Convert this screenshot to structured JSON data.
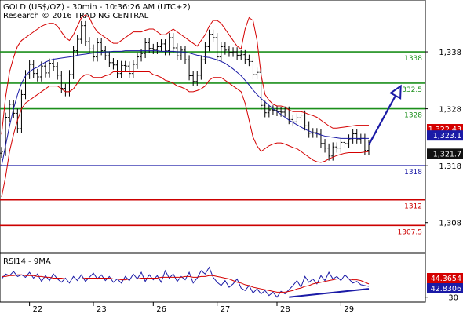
{
  "header": {
    "line1": "GOLD (US$/OZ) - 30min - 10:36:26 AM (UTC+2)",
    "line2": "Research © 2016 TRADING CENTRAL"
  },
  "chart_data": [
    {
      "type": "line",
      "title": "GOLD (US$/OZ) - 30min - 10:36:26 AM (UTC+2)",
      "subtitle": "Research © 2016 TRADING CENTRAL",
      "x_axis": {
        "tick_labels": [
          "22",
          "23",
          "26",
          "27",
          "28",
          "29"
        ]
      },
      "y_axis": {
        "range": [
          1303,
          1346
        ],
        "tick_labels": [
          "1,338",
          "1,328",
          "1,318",
          "1,308"
        ],
        "ticks": [
          1338,
          1328,
          1318,
          1308
        ],
        "position": "right"
      },
      "series": [
        {
          "name": "",
          "kind": "candlestick-close",
          "color": "#000000",
          "values": [
            1320.5,
            1326.5,
            1328.8,
            1327.2,
            1324.5,
            1330.5,
            1334.0,
            1335.8,
            1334.2,
            1333.6,
            1335.5,
            1334.3,
            1336.0,
            1335.4,
            1333.9,
            1331.6,
            1331.0,
            1334.0,
            1338.2,
            1340.2,
            1342.6,
            1339.8,
            1338.5,
            1337.1,
            1339.6,
            1338.2,
            1337.3,
            1336.1,
            1335.7,
            1334.2,
            1335.6,
            1335.5,
            1334.2,
            1335.8,
            1337.1,
            1337.7,
            1339.6,
            1338.6,
            1338.4,
            1338.9,
            1339.4,
            1338.2,
            1340.5,
            1338.7,
            1337.3,
            1338.3,
            1336.6,
            1333.8,
            1332.8,
            1333.9,
            1336.6,
            1338.9,
            1341.1,
            1340.5,
            1337.1,
            1338.9,
            1338.3,
            1337.9,
            1338.0,
            1337.4,
            1337.5,
            1336.7,
            1336.3,
            1334.0,
            1334.4,
            1328.6,
            1327.3,
            1327.8,
            1327.7,
            1327.5,
            1327.4,
            1327.6,
            1326.1,
            1325.7,
            1326.4,
            1326.9,
            1325.0,
            1323.7,
            1323.8,
            1323.7,
            1321.9,
            1321.1,
            1319.7,
            1321.3,
            1321.1,
            1322.1,
            1321.9,
            1322.7,
            1323.6,
            1322.7,
            1322.8,
            1320.7,
            1321.7
          ]
        },
        {
          "name": "",
          "kind": "moving-average",
          "color": "#1a1aa6",
          "values": [
            1318.0,
            1321.5,
            1325.0,
            1328.0,
            1330.5,
            1332.5,
            1333.8,
            1334.5,
            1335.0,
            1335.3,
            1335.8,
            1336.2,
            1336.5,
            1336.7,
            1336.8,
            1336.9,
            1337.0,
            1337.1,
            1337.2,
            1337.4,
            1337.5,
            1337.6,
            1337.7,
            1337.8,
            1337.9,
            1337.9,
            1338.0,
            1338.0,
            1338.1,
            1338.1,
            1338.1,
            1338.2,
            1338.2,
            1338.2,
            1338.2,
            1338.2,
            1338.2,
            1338.2,
            1338.2,
            1338.2,
            1338.1,
            1338.1,
            1338.1,
            1338.1,
            1338.0,
            1338.0,
            1337.9,
            1337.8,
            1337.6,
            1337.4,
            1337.3,
            1337.1,
            1337.0,
            1336.8,
            1336.6,
            1336.3,
            1336.0,
            1335.5,
            1335.0,
            1334.4,
            1333.8,
            1333.0,
            1332.2,
            1331.3,
            1330.5,
            1329.8,
            1329.2,
            1328.6,
            1328.0,
            1327.5,
            1327.0,
            1326.5,
            1326.0,
            1325.6,
            1325.2,
            1324.8,
            1324.4,
            1324.1,
            1323.8,
            1323.6,
            1323.4,
            1323.2,
            1323.1,
            1323.0,
            1322.9,
            1322.8,
            1322.8,
            1322.8,
            1322.8,
            1322.8,
            1322.8,
            1322.8,
            1322.8
          ]
        },
        {
          "name": "",
          "kind": "bollinger-upper",
          "color": "#d40000",
          "values": [
            1323.5,
            1330.0,
            1334.5,
            1337.0,
            1339.0,
            1340.0,
            1340.5,
            1341.0,
            1341.5,
            1342.0,
            1342.5,
            1342.8,
            1343.0,
            1343.0,
            1342.5,
            1341.5,
            1340.5,
            1340.0,
            1341.0,
            1342.5,
            1344.0,
            1344.5,
            1344.0,
            1342.5,
            1341.5,
            1341.0,
            1340.5,
            1340.0,
            1339.5,
            1339.5,
            1340.0,
            1340.5,
            1341.0,
            1341.5,
            1341.5,
            1341.5,
            1341.8,
            1342.0,
            1342.0,
            1341.5,
            1341.0,
            1341.0,
            1341.5,
            1342.0,
            1341.5,
            1341.0,
            1340.5,
            1340.0,
            1339.5,
            1339.0,
            1340.0,
            1341.0,
            1342.5,
            1343.5,
            1343.5,
            1343.0,
            1342.0,
            1341.0,
            1340.0,
            1339.0,
            1338.5,
            1342.0,
            1344.0,
            1343.5,
            1340.0,
            1334.0,
            1330.5,
            1329.5,
            1328.8,
            1328.5,
            1328.5,
            1328.3,
            1327.8,
            1327.5,
            1327.5,
            1327.5,
            1327.3,
            1327.0,
            1326.8,
            1326.5,
            1326.0,
            1325.5,
            1325.0,
            1324.6,
            1324.6,
            1324.7,
            1324.8,
            1324.9,
            1325.0,
            1325.1,
            1325.1,
            1325.1,
            1325.1
          ]
        },
        {
          "name": "",
          "kind": "bollinger-lower",
          "color": "#d40000",
          "values": [
            1312.5,
            1316.0,
            1320.5,
            1323.5,
            1326.0,
            1328.0,
            1329.0,
            1329.5,
            1330.0,
            1330.5,
            1331.0,
            1331.5,
            1332.0,
            1332.0,
            1332.0,
            1331.5,
            1331.0,
            1331.0,
            1331.5,
            1332.5,
            1333.5,
            1334.0,
            1334.0,
            1333.5,
            1333.5,
            1333.5,
            1333.8,
            1334.0,
            1334.5,
            1334.5,
            1334.5,
            1334.5,
            1334.5,
            1334.5,
            1334.5,
            1334.5,
            1334.5,
            1334.5,
            1334.0,
            1333.8,
            1333.5,
            1333.0,
            1332.8,
            1332.5,
            1332.0,
            1331.8,
            1331.5,
            1331.0,
            1331.0,
            1331.2,
            1331.5,
            1332.0,
            1333.0,
            1333.5,
            1333.5,
            1333.5,
            1333.0,
            1332.5,
            1332.0,
            1331.5,
            1331.0,
            1329.0,
            1326.0,
            1323.0,
            1321.5,
            1320.5,
            1321.0,
            1321.5,
            1321.8,
            1322.0,
            1322.0,
            1321.8,
            1321.5,
            1321.2,
            1321.0,
            1320.5,
            1320.0,
            1319.5,
            1319.0,
            1318.7,
            1318.6,
            1318.8,
            1319.2,
            1319.5,
            1319.8,
            1320.0,
            1320.2,
            1320.3,
            1320.3,
            1320.3,
            1320.3,
            1320.4,
            1320.5
          ]
        }
      ],
      "horizontal_levels": [
        {
          "label": "1338",
          "value": 1338.0,
          "color": "#1b8f1b"
        },
        {
          "label": "1332.5",
          "value": 1332.5,
          "color": "#1b8f1b"
        },
        {
          "label": "1328",
          "value": 1328.0,
          "color": "#1b8f1b"
        },
        {
          "label": "1318",
          "value": 1318.0,
          "color": "#1a1aa6"
        },
        {
          "label": "1312",
          "value": 1312.0,
          "color": "#cc0000"
        },
        {
          "label": "1307.5",
          "value": 1307.5,
          "color": "#cc0000"
        }
      ],
      "price_tags": [
        {
          "label": "1,322.43",
          "value": 1322.43,
          "color": "#d40000"
        },
        {
          "label": "1,323.1",
          "value": 1323.1,
          "color": "#1a1aa6"
        },
        {
          "label": "1,321.7",
          "value": 1321.7,
          "color": "#111111"
        }
      ],
      "arrow": {
        "from": [
          92,
          1321.7
        ],
        "to": [
          100,
          1332.0
        ],
        "color": "#1a1aa6"
      },
      "grid": false
    },
    {
      "type": "line",
      "title": "RSI14 - 9MA",
      "y_axis": {
        "range": [
          25,
          80
        ],
        "tick_labels": [
          "30"
        ],
        "ticks": [
          30
        ],
        "position": "right"
      },
      "series": [
        {
          "name": "RSI14",
          "color": "#1a1aa6",
          "values": [
            52,
            58,
            56,
            61,
            55,
            57,
            54,
            60,
            53,
            58,
            49,
            56,
            50,
            58,
            52,
            48,
            53,
            47,
            55,
            50,
            57,
            49,
            54,
            59,
            52,
            57,
            50,
            55,
            48,
            52,
            47,
            55,
            50,
            58,
            52,
            60,
            49,
            57,
            51,
            56,
            48,
            62,
            53,
            58,
            49,
            55,
            51,
            60,
            47,
            53,
            62,
            58,
            66,
            54,
            48,
            44,
            50,
            42,
            46,
            52,
            41,
            38,
            44,
            35,
            40,
            34,
            38,
            32,
            36,
            30,
            37,
            34,
            39,
            44,
            50,
            42,
            55,
            48,
            52,
            46,
            56,
            50,
            60,
            52,
            55,
            50,
            57,
            52,
            47,
            49,
            45,
            44,
            43
          ]
        },
        {
          "name": "9MA",
          "color": "#d40000",
          "values": [
            55,
            55,
            56,
            56,
            57,
            57,
            56,
            56,
            56,
            55,
            55,
            54,
            54,
            53,
            53,
            53,
            52,
            52,
            52,
            52,
            52,
            53,
            53,
            53,
            53,
            53,
            53,
            53,
            52,
            52,
            51,
            51,
            52,
            52,
            52,
            53,
            53,
            53,
            53,
            53,
            54,
            54,
            54,
            54,
            54,
            54,
            55,
            55,
            54,
            54,
            55,
            55,
            56,
            56,
            55,
            54,
            53,
            52,
            50,
            48,
            47,
            45,
            44,
            42,
            41,
            40,
            39,
            38,
            37,
            36,
            36,
            36,
            37,
            38,
            40,
            41,
            43,
            44,
            46,
            47,
            48,
            49,
            50,
            51,
            52,
            52,
            52,
            52,
            51,
            51,
            50,
            48,
            46
          ]
        }
      ],
      "value_tags": [
        {
          "label": "44.3654",
          "value": 44.3654,
          "color": "#d40000"
        },
        {
          "label": "42.8306",
          "value": 42.8306,
          "color": "#1a1aa6"
        }
      ],
      "trendline": {
        "from": [
          72,
          30
        ],
        "to": [
          92,
          40
        ],
        "color": "#1a1aa6"
      }
    }
  ]
}
